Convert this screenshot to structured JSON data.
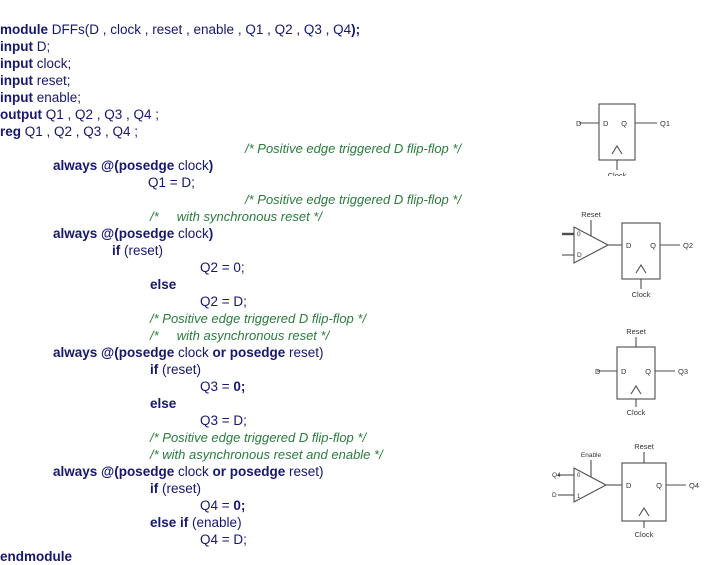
{
  "colors": {
    "background": "#ffffff",
    "keyword": "#17176b",
    "identifier": "#17176b",
    "comment": "#2c7a3e",
    "diagram_stroke": "#4d4d4d",
    "diagram_label": "#333333"
  },
  "code": {
    "language": "Verilog",
    "lines": [
      {
        "indent": 0,
        "parts": [
          {
            "t": "kw",
            "v": "module "
          },
          {
            "t": "id",
            "v": "DFFs(D , clock , reset , enable , Q1 , Q2 , Q3 , Q4"
          },
          {
            "t": "kw",
            "v": ");"
          }
        ]
      },
      {
        "indent": 0,
        "parts": [
          {
            "t": "kw",
            "v": "input "
          },
          {
            "t": "id",
            "v": "D;"
          }
        ]
      },
      {
        "indent": 0,
        "parts": [
          {
            "t": "kw",
            "v": "input "
          },
          {
            "t": "id",
            "v": "clock;"
          }
        ]
      },
      {
        "indent": 0,
        "parts": [
          {
            "t": "kw",
            "v": "input "
          },
          {
            "t": "id",
            "v": "reset;"
          }
        ]
      },
      {
        "indent": 0,
        "parts": [
          {
            "t": "kw",
            "v": "input "
          },
          {
            "t": "id",
            "v": "enable;"
          }
        ]
      },
      {
        "indent": 0,
        "parts": [
          {
            "t": "kw",
            "v": "output "
          },
          {
            "t": "id",
            "v": "Q1 , Q2 , Q3 , Q4 ;"
          }
        ]
      },
      {
        "indent": 0,
        "parts": [
          {
            "t": "kw",
            "v": "reg "
          },
          {
            "t": "id",
            "v": "Q1 , Q2 , Q3 , Q4 ;"
          }
        ]
      },
      {
        "indent": 245,
        "parts": [
          {
            "t": "cmt",
            "v": "/* Positive edge triggered D flip-flop */"
          }
        ]
      },
      {
        "indent": 53,
        "parts": [
          {
            "t": "kw",
            "v": "always @(posedge "
          },
          {
            "t": "id",
            "v": "clock"
          },
          {
            "t": "kw",
            "v": ")"
          }
        ]
      },
      {
        "indent": 148,
        "parts": [
          {
            "t": "id",
            "v": "Q1 = D;"
          }
        ]
      },
      {
        "indent": 245,
        "parts": [
          {
            "t": "cmt",
            "v": "/* Positive edge triggered D flip-flop */"
          }
        ]
      },
      {
        "indent": 150,
        "parts": [
          {
            "t": "cmt",
            "v": "/*     with synchronous reset */"
          }
        ]
      },
      {
        "indent": 53,
        "parts": [
          {
            "t": "kw",
            "v": "always @(posedge "
          },
          {
            "t": "id",
            "v": "clock"
          },
          {
            "t": "kw",
            "v": ")"
          }
        ]
      },
      {
        "indent": 112,
        "parts": [
          {
            "t": "kw",
            "v": "if "
          },
          {
            "t": "id",
            "v": "(reset)"
          }
        ]
      },
      {
        "indent": 200,
        "parts": [
          {
            "t": "id",
            "v": "Q2 = 0;"
          }
        ]
      },
      {
        "indent": 150,
        "parts": [
          {
            "t": "kw",
            "v": "else"
          }
        ]
      },
      {
        "indent": 200,
        "parts": [
          {
            "t": "id",
            "v": "Q2 = D;"
          }
        ]
      },
      {
        "indent": 150,
        "parts": [
          {
            "t": "cmt",
            "v": "/* Positive edge triggered D flip-flop */"
          }
        ]
      },
      {
        "indent": 150,
        "parts": [
          {
            "t": "cmt",
            "v": "/*     with asynchronous reset */"
          }
        ]
      },
      {
        "indent": 53,
        "parts": [
          {
            "t": "kw",
            "v": "always @(posedge "
          },
          {
            "t": "id",
            "v": "clock "
          },
          {
            "t": "kw",
            "v": "or posedge "
          },
          {
            "t": "id",
            "v": "reset)"
          }
        ]
      },
      {
        "indent": 150,
        "parts": [
          {
            "t": "kw",
            "v": "if "
          },
          {
            "t": "id",
            "v": "(reset)"
          }
        ]
      },
      {
        "indent": 200,
        "parts": [
          {
            "t": "id",
            "v": "Q3 = "
          },
          {
            "t": "kw",
            "v": "0;"
          }
        ]
      },
      {
        "indent": 150,
        "parts": [
          {
            "t": "kw",
            "v": "else"
          }
        ]
      },
      {
        "indent": 200,
        "parts": [
          {
            "t": "id",
            "v": "Q3 = D;"
          }
        ]
      },
      {
        "indent": 150,
        "parts": [
          {
            "t": "cmt",
            "v": "/* Positive edge triggered D flip-flop */"
          }
        ]
      },
      {
        "indent": 150,
        "parts": [
          {
            "t": "cmt",
            "v": "/* with asynchronous reset and enable */"
          }
        ]
      },
      {
        "indent": 53,
        "parts": [
          {
            "t": "kw",
            "v": "always @(posedge "
          },
          {
            "t": "id",
            "v": "clock "
          },
          {
            "t": "kw",
            "v": "or posedge "
          },
          {
            "t": "id",
            "v": "reset)"
          }
        ]
      },
      {
        "indent": 150,
        "parts": [
          {
            "t": "kw",
            "v": "if "
          },
          {
            "t": "id",
            "v": "(reset)"
          }
        ]
      },
      {
        "indent": 200,
        "parts": [
          {
            "t": "id",
            "v": "Q4 = "
          },
          {
            "t": "kw",
            "v": "0;"
          }
        ]
      },
      {
        "indent": 150,
        "parts": [
          {
            "t": "kw",
            "v": "else if "
          },
          {
            "t": "id",
            "v": "(enable)"
          }
        ]
      },
      {
        "indent": 200,
        "parts": [
          {
            "t": "id",
            "v": "Q4 = D;"
          }
        ]
      },
      {
        "indent": 0,
        "parts": [
          {
            "t": "kw",
            "v": "endmodule"
          }
        ]
      }
    ]
  },
  "diagrams": [
    {
      "name": "dff-q1",
      "kind": "dff",
      "has_mux": false,
      "has_reset_top": false,
      "left_label": "D",
      "port_d": "D",
      "port_q": "Q",
      "output_label": "Q1",
      "clock_label": "Clock"
    },
    {
      "name": "dff-q2-sync-reset",
      "kind": "dff-mux",
      "has_mux": true,
      "has_reset_top": false,
      "mux_select_label": "Reset",
      "mux_in0": "0",
      "mux_in1": "D",
      "port_d": "D",
      "port_q": "Q",
      "output_label": "Q2",
      "clock_label": "Clock"
    },
    {
      "name": "dff-q3-async-reset",
      "kind": "dff-reset",
      "has_mux": false,
      "has_reset_top": true,
      "reset_label": "Reset",
      "left_label": "D",
      "port_d": "D",
      "port_q": "Q",
      "output_label": "Q3",
      "clock_label": "Clock"
    },
    {
      "name": "dff-q4-async-reset-enable",
      "kind": "dff-mux-reset",
      "has_mux": true,
      "has_reset_top": true,
      "reset_label": "Reset",
      "mux_select_label": "Enable",
      "mux_in0": "Q4",
      "mux_in1": "D",
      "port_d": "D",
      "port_q": "Q",
      "output_label": "Q4",
      "clock_label": "Clock"
    }
  ]
}
